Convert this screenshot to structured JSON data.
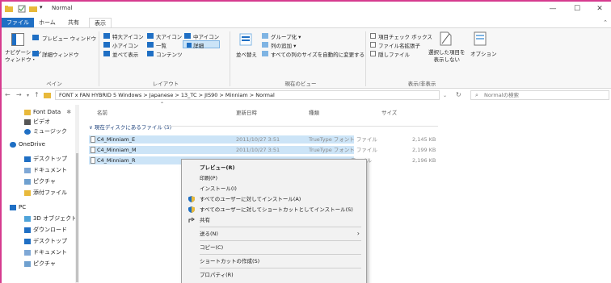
{
  "window": {
    "title": "Normal",
    "min_glyph": "—",
    "max_glyph": "☐",
    "close_glyph": "✕"
  },
  "ribbon_tabs": [
    "ファイル",
    "ホーム",
    "共有",
    "表示"
  ],
  "ribbon": {
    "pane": {
      "nav_pane": "ナビゲーション\nウィンドウ・",
      "preview": "プレビュー ウィンドウ",
      "details": "詳細ウィンドウ",
      "label": "ペイン"
    },
    "layout": {
      "extra_large": "特大アイコン",
      "large": "大アイコン",
      "medium": "中アイコン",
      "small": "小アイコン",
      "list": "一覧",
      "details": "詳細",
      "tiles": "並べて表示",
      "content": "コンテンツ",
      "label": "レイアウト"
    },
    "current_view": {
      "sort": "並べ替え",
      "group": "グループ化 ▾",
      "add_column": "列の追加 ▾",
      "fit_columns": "すべての列のサイズを自動的に変更する",
      "label": "現在のビュー"
    },
    "show_hide": {
      "item_checkboxes": "項目チェック ボックス",
      "extensions": "ファイル名拡張子",
      "hidden": "隠しファイル",
      "hide_selected": "選択した項目を\n表示しない",
      "options": "オプション",
      "label": "表示/非表示"
    }
  },
  "address": {
    "path": "FONT x FAN HYBRID 5 Windows  >  Japanese  >  13_TC  >  JIS90  >  Minniam  >  Normal",
    "search_placeholder": "Normalの検索"
  },
  "nav_pane": {
    "items": [
      "Font Data",
      "ビデオ",
      "ミュージック",
      "OneDrive",
      "デスクトップ",
      "ドキュメント",
      "ピクチャ",
      "添付ファイル",
      "PC",
      "3D オブジェクト",
      "ダウンロード",
      "デスクトップ",
      "ドキュメント",
      "ピクチャ"
    ]
  },
  "columns": [
    "名前",
    "更新日時",
    "種類",
    "サイズ"
  ],
  "group_label": "現在ディスクにあるファイル (3)",
  "files": [
    {
      "name": "C4_Minniam_E",
      "date": "2011/10/27 3:51",
      "type": "TrueType フォント ファイル",
      "size": "2,145 KB"
    },
    {
      "name": "C4_Minniam_M",
      "date": "2011/10/27 3:51",
      "type": "TrueType フォント ファイル",
      "size": "2,199 KB"
    },
    {
      "name": "C4_Minniam_R",
      "date": "",
      "type": "ファイル",
      "size": "2,196 KB"
    }
  ],
  "context_menu": {
    "items": [
      "プレビュー(R)",
      "印刷(P)",
      "インストール(I)",
      "すべてのユーザーに対してインストール(A)",
      "すべてのユーザーに対してショートカットとしてインストール(S)",
      "共有",
      "送る(N)",
      "コピー(C)",
      "ショートカットの作成(S)",
      "プロパティ(R)"
    ]
  },
  "colors": {
    "accent": "#1f6fc4",
    "selection": "#cce4f7",
    "frame": "#d63b8f"
  }
}
